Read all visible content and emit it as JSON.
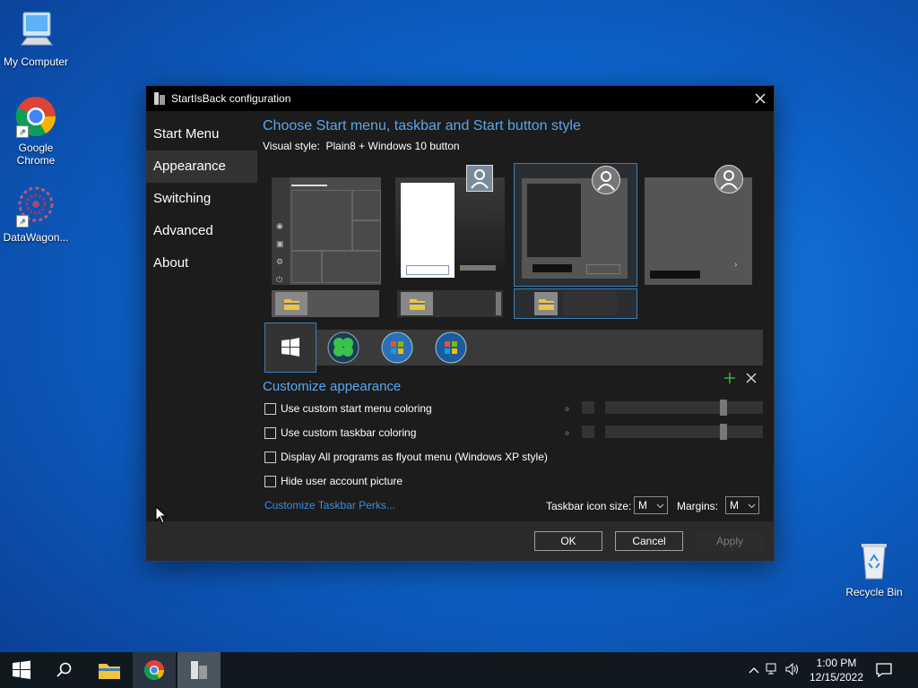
{
  "desktop": {
    "icons": [
      {
        "label": "My Computer"
      },
      {
        "label": "Google Chrome"
      },
      {
        "label": "DataWagon..."
      },
      {
        "label": "Recycle Bin"
      }
    ]
  },
  "dialog": {
    "title": "StartIsBack configuration",
    "nav": [
      {
        "label": "Start Menu"
      },
      {
        "label": "Appearance"
      },
      {
        "label": "Switching"
      },
      {
        "label": "Advanced"
      },
      {
        "label": "About"
      }
    ],
    "style_heading": "Choose Start menu, taskbar and Start button style",
    "visual_style_label": "Visual style:",
    "visual_style_value": "Plain8 + Windows 10 button",
    "customize_heading": "Customize appearance",
    "options": [
      {
        "label": "Use custom start menu coloring",
        "checked": false
      },
      {
        "label": "Use custom taskbar coloring",
        "checked": false
      },
      {
        "label": "Display All programs as flyout menu (Windows XP style)",
        "checked": false
      },
      {
        "label": "Hide user account picture",
        "checked": false
      }
    ],
    "perks_link": "Customize Taskbar Perks...",
    "icon_size_label": "Taskbar icon size:",
    "icon_size_value": "M",
    "margins_label": "Margins:",
    "margins_value": "M",
    "ok_label": "OK",
    "cancel_label": "Cancel",
    "apply_label": "Apply"
  },
  "taskbar": {
    "time": "1:00 PM",
    "date": "12/15/2022"
  },
  "colors": {
    "accent_blue": "#5aa6f0",
    "link_blue": "#3b8edb",
    "dialog_bg": "#1c1c1c"
  }
}
